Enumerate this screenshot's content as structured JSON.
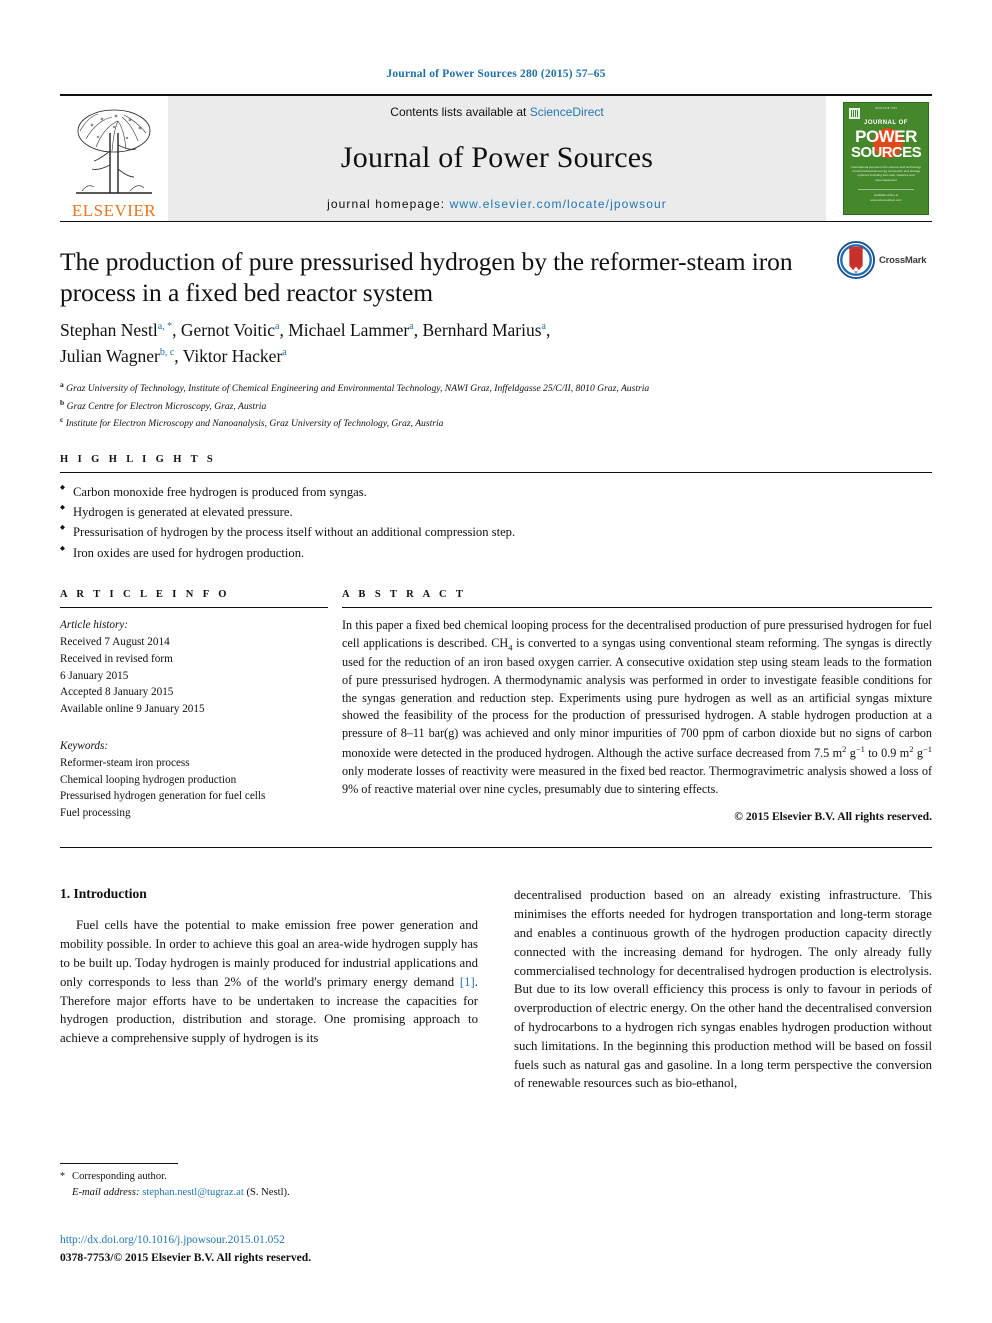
{
  "running_head": "Journal of Power Sources 280 (2015) 57–65",
  "masthead": {
    "contents_prefix": "Contents lists available at ",
    "contents_link": "ScienceDirect",
    "journal_title": "Journal of Power Sources",
    "homepage_label": "journal homepage: ",
    "homepage_url": "www.elsevier.com/locate/jpowsour",
    "publisher": "ELSEVIER",
    "cover": {
      "top_line": "ISSN 0378-7753",
      "line1": "JOURNAL OF",
      "line2": "POWER",
      "line3": "SOURCES",
      "subtitle": "International journal on the science and technology of electrochemical energy conversion and storage systems including fuel cells, batteries and supercapacitors",
      "bottom": "Available online at\nwww.sciencedirect.com"
    }
  },
  "article": {
    "title": "The production of pure pressurised hydrogen by the reformer-steam iron process in a fixed bed reactor system",
    "crossmark_label": "CrossMark",
    "authors_line1": "Stephan Nestl",
    "authors": [
      {
        "name": "Stephan Nestl",
        "marks": "a, *"
      },
      {
        "name": "Gernot Voitic",
        "marks": "a"
      },
      {
        "name": "Michael Lammer",
        "marks": "a"
      },
      {
        "name": "Bernhard Marius",
        "marks": "a"
      },
      {
        "name": "Julian Wagner",
        "marks": "b, c"
      },
      {
        "name": "Viktor Hacker",
        "marks": "a"
      }
    ],
    "affiliations": [
      {
        "mark": "a",
        "text": "Graz University of Technology, Institute of Chemical Engineering and Environmental Technology, NAWI Graz, Inffeldgasse 25/C/II, 8010 Graz, Austria"
      },
      {
        "mark": "b",
        "text": "Graz Centre for Electron Microscopy, Graz, Austria"
      },
      {
        "mark": "c",
        "text": "Institute for Electron Microscopy and Nanoanalysis, Graz University of Technology, Graz, Austria"
      }
    ]
  },
  "highlights": {
    "heading": "H I G H L I G H T S",
    "items": [
      "Carbon monoxide free hydrogen is produced from syngas.",
      "Hydrogen is generated at elevated pressure.",
      "Pressurisation of hydrogen by the process itself without an additional compression step.",
      "Iron oxides are used for hydrogen production."
    ]
  },
  "article_info": {
    "heading": "A R T I C L E   I N F O",
    "history_label": "Article history:",
    "history": [
      "Received 7 August 2014",
      "Received in revised form",
      "6 January 2015",
      "Accepted 8 January 2015",
      "Available online 9 January 2015"
    ],
    "keywords_label": "Keywords:",
    "keywords": [
      "Reformer-steam iron process",
      "Chemical looping hydrogen production",
      "Pressurised hydrogen generation for fuel cells",
      "Fuel processing"
    ]
  },
  "abstract": {
    "heading": "A B S T R A C T",
    "p1a": "In this paper a fixed bed chemical looping process for the decentralised production of pure pressurised hydrogen for fuel cell applications is described. CH",
    "p1_sub": "4",
    "p1b": " is converted to a syngas using conventional steam reforming. The syngas is directly used for the reduction of an iron based oxygen carrier. A consecutive oxidation step using steam leads to the formation of pure pressurised hydrogen. A thermodynamic analysis was performed in order to investigate feasible conditions for the syngas generation and reduction step. Experiments using pure hydrogen as well as an artificial syngas mixture showed the feasibility of the process for the production of pressurised hydrogen. A stable hydrogen production at a pressure of 8–11 bar(g) was achieved and only minor impurities of 700 ppm of carbon dioxide but no signs of carbon monoxide were detected in the produced hydrogen. Although the active surface decreased from 7.5 m",
    "p1c": " g",
    "p1d": " to 0.9 m",
    "p1e": " g",
    "p1f": " only moderate losses of reactivity were measured in the fixed bed reactor. Thermogravimetric analysis showed a loss of 9% of reactive material over nine cycles, presumably due to sintering effects.",
    "sup2": "2",
    "supm1": "−1",
    "copyright": "© 2015 Elsevier B.V. All rights reserved."
  },
  "introduction": {
    "heading": "1.  Introduction",
    "left_p1a": "Fuel cells have the potential to make emission free power generation and mobility possible. In order to achieve this goal an area-wide hydrogen supply has to be built up. Today hydrogen is mainly produced for industrial applications and only corresponds to less than 2% of the world's primary energy demand ",
    "left_ref": "[1]",
    "left_p1b": ". Therefore major efforts have to be undertaken to increase the capacities for hydrogen production, distribution and storage. One promising approach to achieve a comprehensive supply of hydrogen is its",
    "right_p1": "decentralised production based on an already existing infrastructure. This minimises the efforts needed for hydrogen transportation and long-term storage and enables a continuous growth of the hydrogen production capacity directly connected with the increasing demand for hydrogen. The only already fully commercialised technology for decentralised hydrogen production is electrolysis. But due to its low overall efficiency this process is only to favour in periods of overproduction of electric energy. On the other hand the decentralised conversion of hydrocarbons to a hydrogen rich syngas enables hydrogen production without such limitations. In the beginning this production method will be based on fossil fuels such as natural gas and gasoline. In a long term perspective the conversion of renewable resources such as bio-ethanol,"
  },
  "footnote": {
    "corresponding": "Corresponding author.",
    "email_label": "E-mail address:",
    "email": "stephan.nestl@tugraz.at",
    "email_owner": "(S. Nestl)."
  },
  "footer": {
    "doi": "http://dx.doi.org/10.1016/j.jpowsour.2015.01.052",
    "issn": "0378-7753/© 2015 Elsevier B.V. All rights reserved."
  },
  "colors": {
    "link": "#2176b5",
    "elsevier_orange": "#E87722",
    "cover_green": "#44882b",
    "crossmark_red": "#c7302b"
  }
}
